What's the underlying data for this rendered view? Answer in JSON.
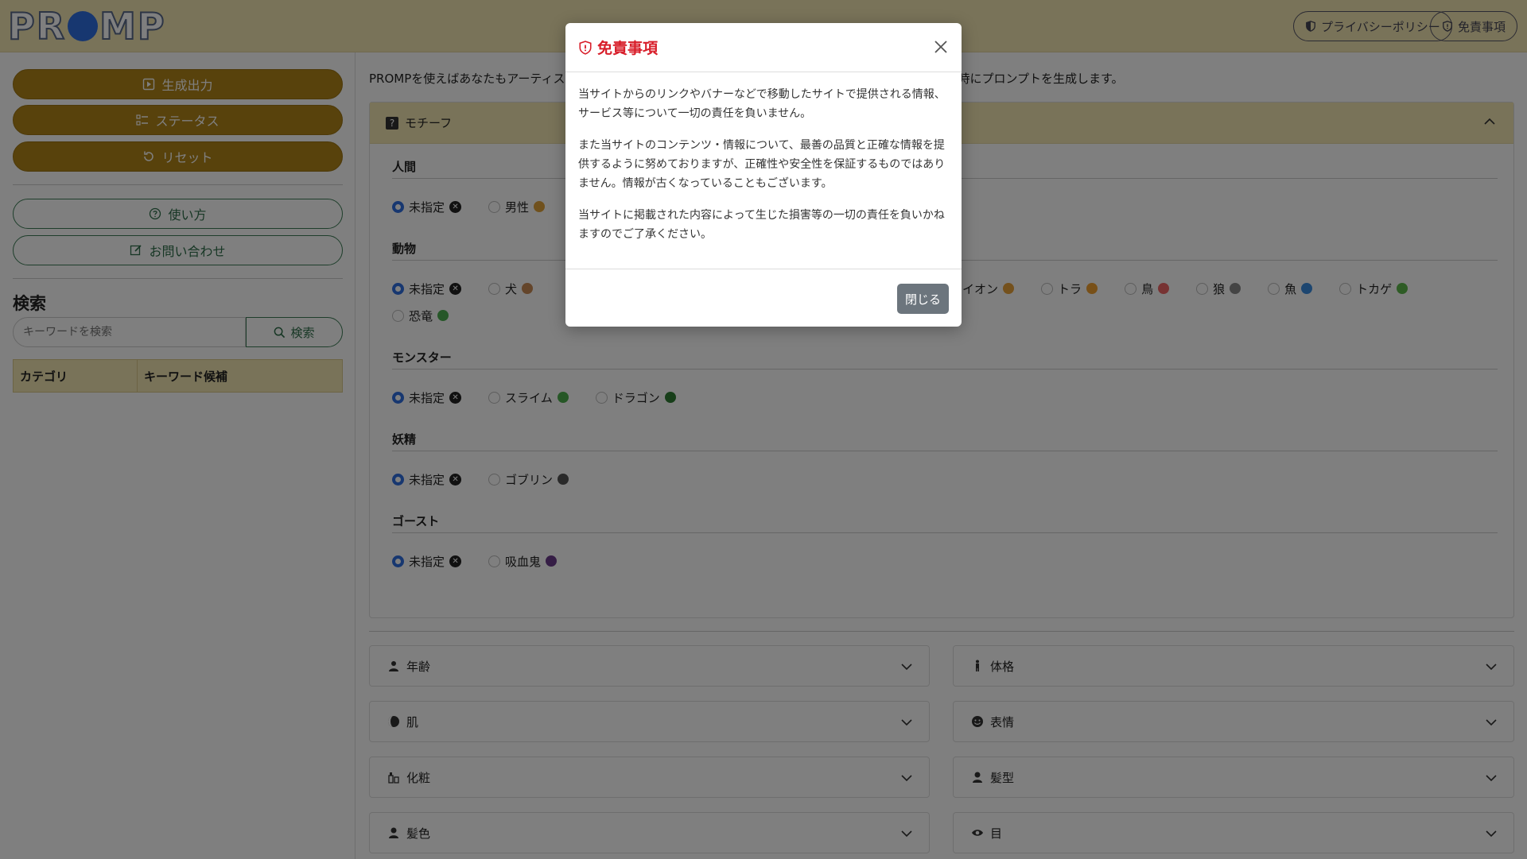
{
  "header": {
    "logo_text": "PROMP",
    "privacy_label": "プライバシーポリシー",
    "disclaimer_label": "免責事項"
  },
  "sidebar": {
    "generate_label": "生成出力",
    "status_label": "ステータス",
    "reset_label": "リセット",
    "howto_label": "使い方",
    "contact_label": "お問い合わせ",
    "search_title": "検索",
    "search_placeholder": "キーワードを検索",
    "search_button": "検索",
    "table_headers": [
      "カテゴリ",
      "キーワード候補"
    ]
  },
  "main": {
    "intro_left": "PROMPを使えばあなたもアーティストに",
    "intro_right": "時にプロンプトを生成します。",
    "motif_title": "モチーフ",
    "categories": [
      {
        "title": "人間",
        "options": [
          {
            "label": "未指定",
            "selected": true
          },
          {
            "label": "男性",
            "selected": false
          }
        ]
      },
      {
        "title": "動物",
        "options": [
          {
            "label": "未指定",
            "selected": true
          },
          {
            "label": "犬",
            "selected": false
          },
          {
            "label": "ライオン",
            "selected": false
          },
          {
            "label": "トラ",
            "selected": false
          },
          {
            "label": "鳥",
            "selected": false
          },
          {
            "label": "狼",
            "selected": false
          },
          {
            "label": "魚",
            "selected": false
          },
          {
            "label": "トカゲ",
            "selected": false
          },
          {
            "label": "恐竜",
            "selected": false
          }
        ]
      },
      {
        "title": "モンスター",
        "options": [
          {
            "label": "未指定",
            "selected": true
          },
          {
            "label": "スライム",
            "selected": false
          },
          {
            "label": "ドラゴン",
            "selected": false
          }
        ]
      },
      {
        "title": "妖精",
        "options": [
          {
            "label": "未指定",
            "selected": true
          },
          {
            "label": "ゴブリン",
            "selected": false
          }
        ]
      },
      {
        "title": "ゴースト",
        "options": [
          {
            "label": "未指定",
            "selected": true
          },
          {
            "label": "吸血鬼",
            "selected": false
          }
        ]
      }
    ],
    "accordions": [
      "年齢",
      "体格",
      "肌",
      "表情",
      "化粧",
      "髪型",
      "髪色",
      "目"
    ]
  },
  "modal": {
    "title": "免責事項",
    "paragraphs": [
      "当サイトからのリンクやバナーなどで移動したサイトで提供される情報、サービス等について一切の責任を負いません。",
      "また当サイトのコンテンツ・情報について、最善の品質と正確な情報を提供するように努めておりますが、正確性や安全性を保証するものではありません。情報が古くなっていることもございます。",
      "当サイトに掲載された内容によって生じた損害等の一切の責任を負いかねますのでご了承ください。"
    ],
    "close_button": "閉じる"
  },
  "colors": {
    "header_bg": "#f3e6b2",
    "primary_button": "#b08418",
    "outline_green": "#3c7d56",
    "radio_blue": "#2f6fe0",
    "modal_title_red": "#d81e2a"
  }
}
